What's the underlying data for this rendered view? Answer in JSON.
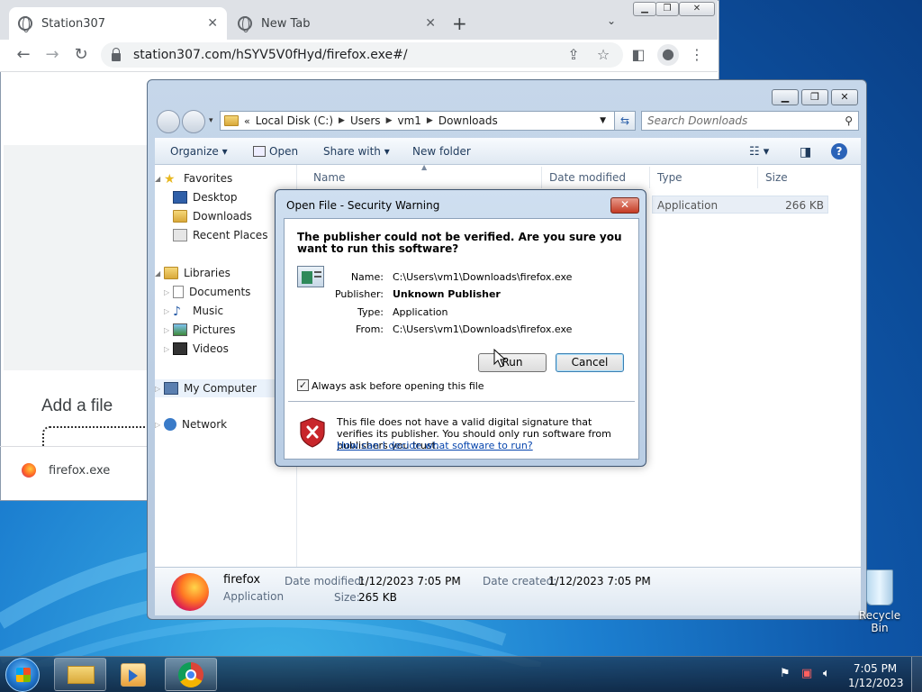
{
  "browser": {
    "tabs": [
      {
        "label": "Station307",
        "active": true
      },
      {
        "label": "New Tab",
        "active": false
      }
    ],
    "url": "station307.com/hSYV5V0fHyd/firefox.exe#/",
    "page": {
      "add_file": "Add a file",
      "download_item": "firefox.exe"
    }
  },
  "explorer": {
    "breadcrumb": [
      "Local Disk (C:)",
      "Users",
      "vm1",
      "Downloads"
    ],
    "search_placeholder": "Search Downloads",
    "toolbar": {
      "organize": "Organize",
      "open": "Open",
      "share_with": "Share with",
      "new_folder": "New folder"
    },
    "nav": {
      "favorites": "Favorites",
      "desktop": "Desktop",
      "downloads": "Downloads",
      "recent_places": "Recent Places",
      "libraries": "Libraries",
      "documents": "Documents",
      "music": "Music",
      "pictures": "Pictures",
      "videos": "Videos",
      "my_computer": "My Computer",
      "network": "Network"
    },
    "columns": {
      "name": "Name",
      "date_modified": "Date modified",
      "type": "Type",
      "size": "Size"
    },
    "row": {
      "type": "Application",
      "size": "266 KB"
    },
    "details": {
      "name": "firefox",
      "type": "Application",
      "date_modified_label": "Date modified:",
      "date_modified": "1/12/2023 7:05 PM",
      "date_created_label": "Date created:",
      "date_created": "1/12/2023 7:05 PM",
      "size_label": "Size:",
      "size": "265 KB"
    }
  },
  "dialog": {
    "title": "Open File - Security Warning",
    "question": "The publisher could not be verified.  Are you sure you want to run this software?",
    "fields": {
      "name_label": "Name:",
      "name": "C:\\Users\\vm1\\Downloads\\firefox.exe",
      "publisher_label": "Publisher:",
      "publisher": "Unknown Publisher",
      "type_label": "Type:",
      "type": "Application",
      "from_label": "From:",
      "from": "C:\\Users\\vm1\\Downloads\\firefox.exe"
    },
    "run_label": "Run",
    "cancel_label": "Cancel",
    "checkbox_label": "Always ask before opening this file",
    "checkbox_checked": true,
    "warning_text": "This file does not have a valid digital signature that verifies its publisher.  You should only run software from publishers you trust.",
    "warning_link": "How can I decide what software to run?"
  },
  "desktop": {
    "recycle_bin": "Recycle Bin"
  },
  "taskbar": {
    "time": "7:05 PM",
    "date": "1/12/2023"
  }
}
